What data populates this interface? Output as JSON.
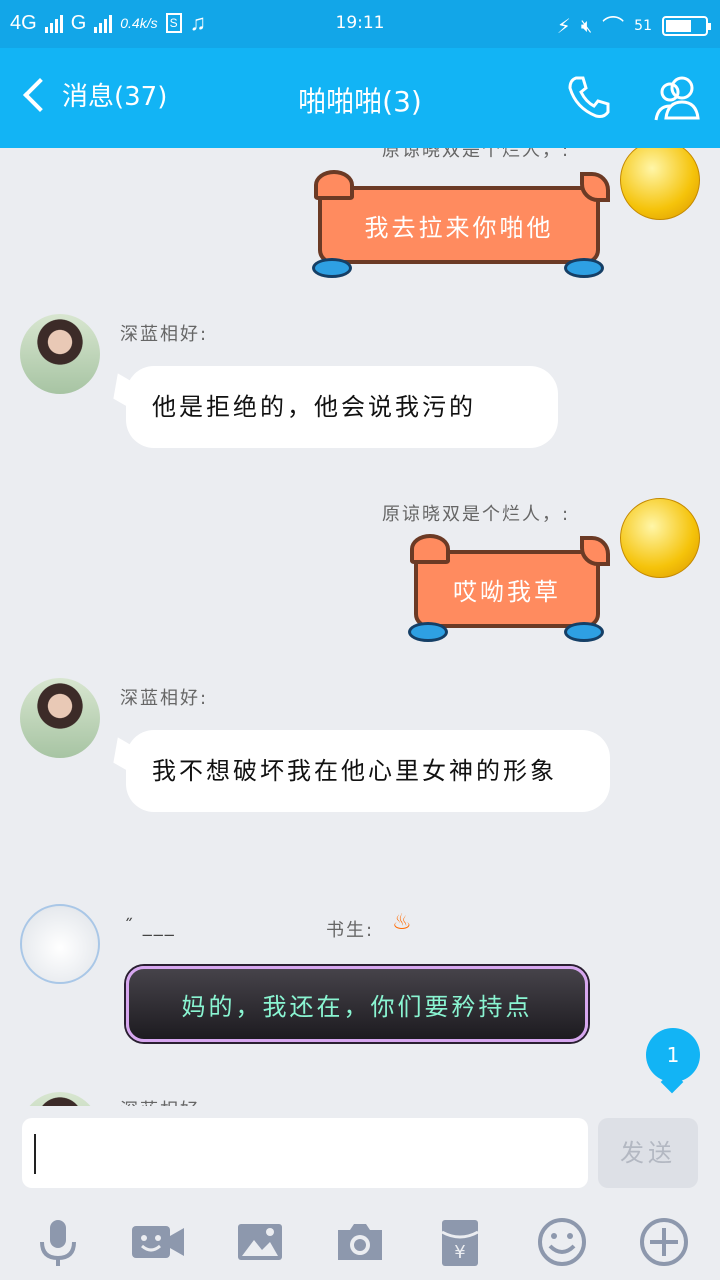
{
  "status": {
    "network1": "4G",
    "network2": "G",
    "speed": "0.4k/s",
    "s_badge": "S",
    "time": "19:11",
    "battery_pct": "51",
    "icons": [
      "signal-icon",
      "music-icon",
      "charging-icon",
      "mute-icon",
      "wifi-icon",
      "battery-icon"
    ]
  },
  "header": {
    "back_label": "消息(37)",
    "title": "啪啪啪(3)",
    "icons": [
      "back-chevron-icon",
      "phone-icon",
      "group-icon"
    ]
  },
  "messages": [
    {
      "sender": "原谅晓双是个烂人，:",
      "text": "我去拉来你啪他",
      "side": "right",
      "style": "fish"
    },
    {
      "sender": "深蓝相好:",
      "text": "他是拒绝的，他会说我污的",
      "side": "left",
      "style": "bubble"
    },
    {
      "sender": "原谅晓双是个烂人，:",
      "text": "哎呦我草",
      "side": "right",
      "style": "fish"
    },
    {
      "sender": "深蓝相好:",
      "text": "我不想破坏我在他心里女神的形象",
      "side": "left",
      "style": "bubble"
    },
    {
      "sender_prefix": "˝ ___",
      "sender": "书生:",
      "text": "妈的，我还在，你们要矜持点",
      "side": "left",
      "style": "dark"
    },
    {
      "sender": "深蓝相好:",
      "side": "left",
      "style": "bubble"
    }
  ],
  "unread_badge": "1",
  "composer": {
    "value": "",
    "send_label": "发送"
  },
  "toolbar": [
    "microphone-icon",
    "video-icon",
    "image-icon",
    "camera-icon",
    "red-packet-icon",
    "emoji-icon",
    "plus-icon"
  ]
}
